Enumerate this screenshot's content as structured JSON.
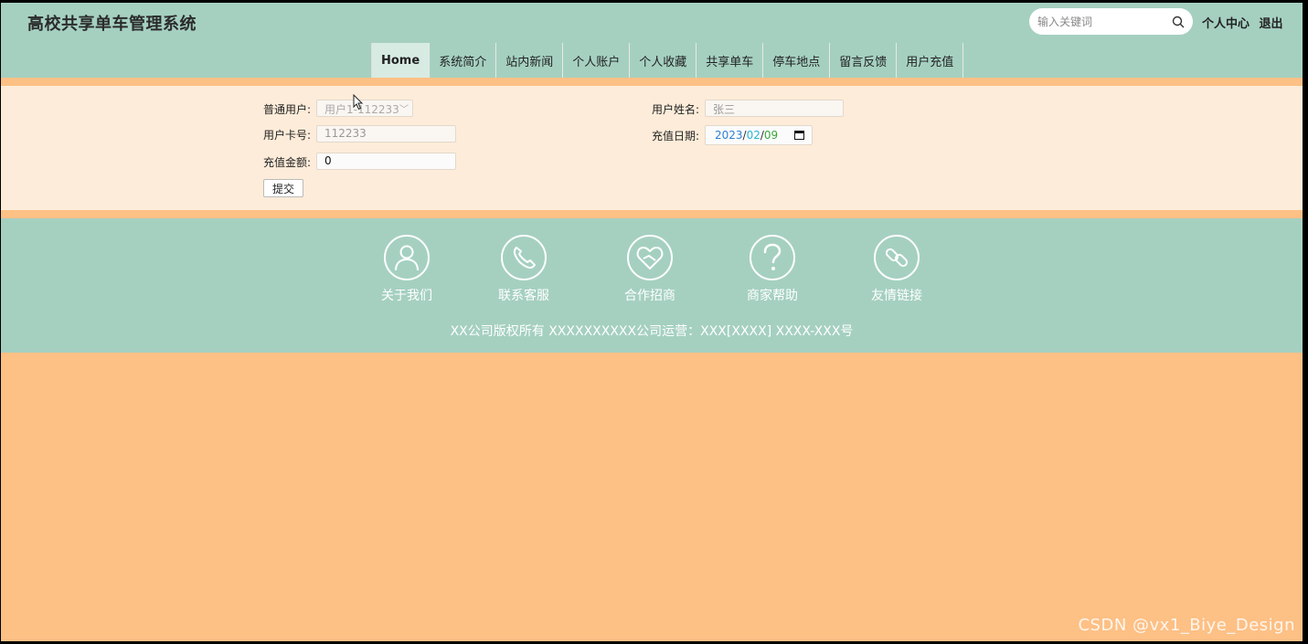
{
  "header": {
    "title": "高校共享单车管理系统",
    "search": {
      "placeholder": "输入关键词",
      "value": ""
    },
    "links": [
      "个人中心",
      "退出"
    ]
  },
  "nav": {
    "items": [
      "Home",
      "系统简介",
      "站内新闻",
      "个人账户",
      "个人收藏",
      "共享单车",
      "停车地点",
      "留言反馈",
      "用户充值"
    ],
    "active": "Home"
  },
  "form": {
    "user_label": "普通用户:",
    "user_value": "用户1-112233",
    "name_label": "用户姓名:",
    "name_value": "张三",
    "card_label": "用户卡号:",
    "card_value": "112233",
    "date_label": "充值日期:",
    "date": {
      "year": "2023",
      "month": "02",
      "day": "09",
      "sep": "/"
    },
    "amount_label": "充值金额:",
    "amount_value": "0",
    "submit_label": "提交"
  },
  "footer": {
    "items": [
      {
        "label": "关于我们",
        "icon": "person-icon"
      },
      {
        "label": "联系客服",
        "icon": "phone-icon"
      },
      {
        "label": "合作招商",
        "icon": "heart-handshake-icon"
      },
      {
        "label": "商家帮助",
        "icon": "question-icon"
      },
      {
        "label": "友情链接",
        "icon": "link-icon"
      }
    ],
    "copyright": "XX公司版权所有 XXXXXXXXXX公司运营：XXX[XXXX] XXXX-XXX号"
  },
  "watermark": "CSDN @vx1_Biye_Design",
  "colors": {
    "header_bg": "#a5d0c0",
    "page_bg": "#fdc085",
    "form_bg": "#fdecd9"
  }
}
